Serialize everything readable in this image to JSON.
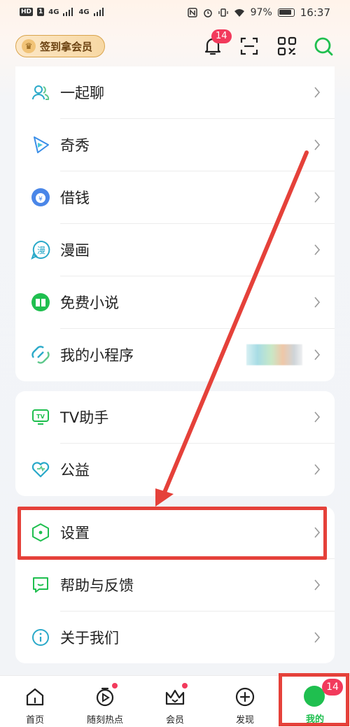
{
  "status_bar": {
    "left_chips": [
      "HD",
      "1",
      "4G",
      "4G"
    ],
    "battery": "97%",
    "time": "16:37"
  },
  "header": {
    "checkin_label": "签到拿会员",
    "notification_badge": "14"
  },
  "group1": [
    {
      "label": "一起聊",
      "icon": "chat-people-icon"
    },
    {
      "label": "奇秀",
      "icon": "play-triangle-icon"
    },
    {
      "label": "借钱",
      "icon": "money-bag-icon"
    },
    {
      "label": "漫画",
      "icon": "comic-icon"
    },
    {
      "label": "免费小说",
      "icon": "book-icon"
    },
    {
      "label": "我的小程序",
      "icon": "mini-program-icon"
    }
  ],
  "group2": [
    {
      "label": "TV助手",
      "icon": "tv-icon"
    },
    {
      "label": "公益",
      "icon": "heart-icon"
    }
  ],
  "group3": [
    {
      "label": "设置",
      "icon": "settings-hexagon-icon"
    },
    {
      "label": "帮助与反馈",
      "icon": "feedback-icon"
    },
    {
      "label": "关于我们",
      "icon": "info-icon"
    }
  ],
  "tabs": [
    {
      "label": "首页",
      "icon": "home-icon"
    },
    {
      "label": "随刻热点",
      "icon": "hot-play-icon"
    },
    {
      "label": "会员",
      "icon": "vip-crown-icon"
    },
    {
      "label": "发现",
      "icon": "plus-circle-icon"
    },
    {
      "label": "我的",
      "icon": "avatar-icon"
    }
  ],
  "tab_badge": "14",
  "colors": {
    "accent_green": "#1fbf4f",
    "badge_red": "#f23a5c",
    "annotation_red": "#e5413a"
  }
}
